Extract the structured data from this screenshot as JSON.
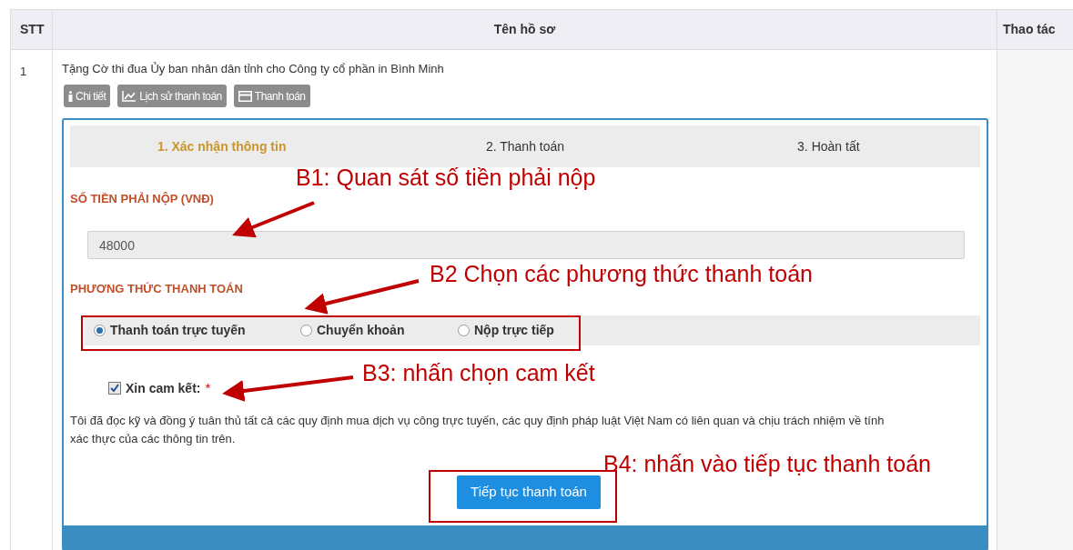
{
  "table": {
    "columns": [
      "STT",
      "Tên hồ sơ",
      "Thao tác"
    ],
    "rows": [
      {
        "stt": "1",
        "name": "Tặng Cờ thi đua Ủy ban nhân dân tỉnh cho Công ty cổ phần in Bình Minh",
        "actions": [
          {
            "kind": "info",
            "label": "Chi tiết"
          },
          {
            "kind": "chart",
            "label": "Lịch sử thanh toán"
          },
          {
            "kind": "card",
            "label": "Thanh toán"
          }
        ]
      }
    ]
  },
  "payment": {
    "steps": [
      {
        "label": "1. Xác nhận thông tin",
        "selected": true
      },
      {
        "label": "2. Thanh toán",
        "selected": false
      },
      {
        "label": "3. Hoàn tất",
        "selected": false
      }
    ],
    "amount_label": "SỐ TIỀN PHẢI NỘP (VNĐ)",
    "amount": "48000",
    "method_label": "PHƯƠNG THỨC THANH TOÁN",
    "methods": [
      {
        "label": "Thanh toán trực tuyến",
        "selected": true
      },
      {
        "label": "Chuyển khoản",
        "selected": false
      },
      {
        "label": "Nộp trực tiếp",
        "selected": false
      }
    ],
    "commit": {
      "label": "Xin cam kết:",
      "required_mark": "*",
      "checked": true
    },
    "terms": "Tôi đã đọc kỹ và đồng ý tuân thủ tất cả các quy định mua dịch vụ công trực tuyến, các quy định pháp luật Việt Nam có liên quan và chịu trách nhiệm về tính xác thực của các thông tin trên.",
    "submit": "Tiếp tục thanh toán"
  },
  "annotations": [
    "B1: Quan sát số tiền phải nộp",
    "B2 Chọn các phương thức thanh toán",
    "B3: nhấn chọn cam kết",
    "B4: nhấn vào tiếp tục thanh toán"
  ]
}
